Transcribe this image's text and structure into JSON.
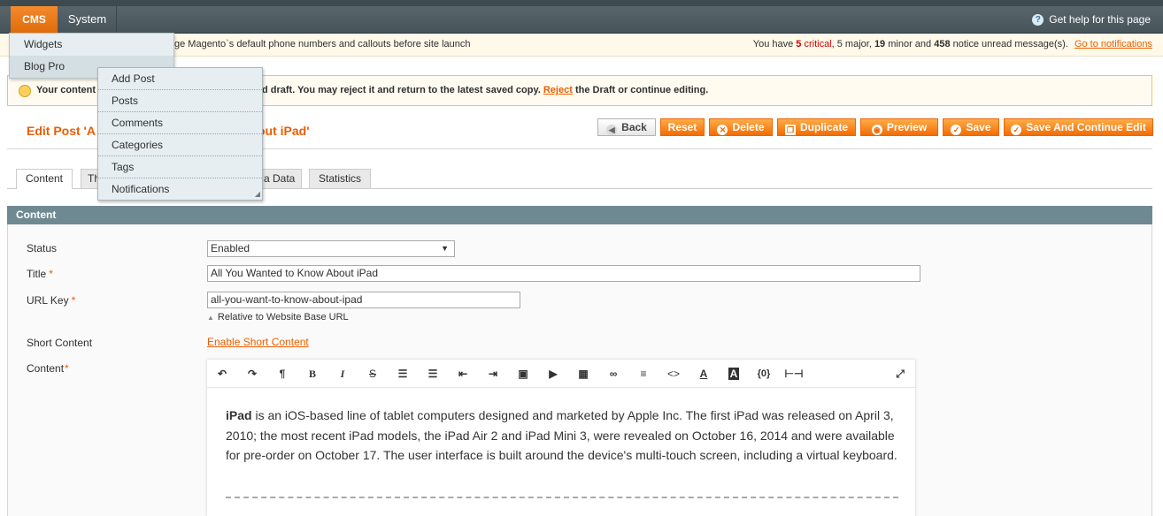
{
  "nav": {
    "cms": "CMS",
    "system": "System",
    "help": "Get help for this page"
  },
  "notice": {
    "left_text": "ge Magento`s default phone numbers and callouts before site launch",
    "right_prefix": "You have ",
    "critical_count": "5",
    "critical_word": " critical",
    "major": ", 5 major, ",
    "minor_count": "19",
    "minor_word": " minor and ",
    "notice_count": "458",
    "notice_word": " notice unread message(s). ",
    "link": "Go to notifications"
  },
  "draft": {
    "part1": "Your content",
    "part2": "d draft. You may reject it and return to the latest saved copy. ",
    "reject_link": "Reject",
    "part3": " the Draft or continue editing."
  },
  "page_title": {
    "left": "Edit Post 'A",
    "right": "out iPad'"
  },
  "buttons": {
    "back": "Back",
    "reset": "Reset",
    "delete": "Delete",
    "duplicate": "Duplicate",
    "preview": "Preview",
    "save": "Save",
    "save_continue": "Save And Continue Edit"
  },
  "tabs": [
    "Content",
    "Th",
    "a Data",
    "Statistics"
  ],
  "section_title": "Content",
  "form": {
    "status_label": "Status",
    "status_value": "Enabled",
    "title_label": "Title",
    "title_value": "All You Wanted to Know About iPad",
    "urlkey_label": "URL Key",
    "urlkey_value": "all-you-want-to-know-about-ipad",
    "urlkey_hint": "Relative to Website Base URL",
    "short_label": "Short Content",
    "short_link": "Enable Short Content",
    "content_label": "Content",
    "required_mark": "*"
  },
  "editor": {
    "bold_word": "iPad",
    "text": " is an iOS-based line of tablet computers designed and marketed by Apple Inc. The first iPad was released on April 3, 2010; the most recent iPad models, the iPad Air 2 and iPad Mini 3, were revealed on October 16, 2014 and were available for pre-order on October 17. The user interface is built around the device's multi-touch screen, including a virtual keyboard.",
    "toolbar_icons": [
      "undo-icon",
      "redo-icon",
      "paragraph-icon",
      "bold-icon",
      "italic-icon",
      "strikethrough-icon",
      "bullet-list-icon",
      "numbered-list-icon",
      "outdent-icon",
      "indent-icon",
      "image-icon",
      "video-icon",
      "table-icon",
      "link-icon",
      "align-icon",
      "code-icon",
      "font-color-icon",
      "background-color-icon",
      "variable-icon",
      "horizontal-rule-icon",
      "fullscreen-icon"
    ]
  },
  "menu_cms": [
    "Widgets",
    "Blog Pro"
  ],
  "menu_blog": [
    "Add Post",
    "Posts",
    "Comments",
    "Categories",
    "Tags",
    "Notifications"
  ]
}
